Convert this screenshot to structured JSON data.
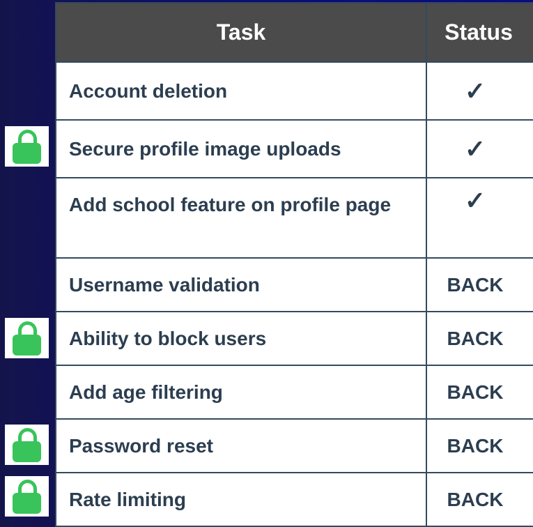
{
  "table": {
    "headers": {
      "task": "Task",
      "status": "Status"
    },
    "rows": [
      {
        "task": "Account deletion",
        "status": "✓",
        "locked": false
      },
      {
        "task": "Secure profile image uploads",
        "status": "✓",
        "locked": true
      },
      {
        "task": "Add school feature on profile page",
        "status": "✓",
        "locked": false
      },
      {
        "task": "Username validation",
        "status": "BACK",
        "locked": false
      },
      {
        "task": "Ability to block users",
        "status": "BACK",
        "locked": true
      },
      {
        "task": "Add age filtering",
        "status": "BACK",
        "locked": false
      },
      {
        "task": "Password reset",
        "status": "BACK",
        "locked": true
      },
      {
        "task": "Rate limiting",
        "status": "BACK",
        "locked": true
      }
    ]
  },
  "colors": {
    "header_bg": "#4b4b4b",
    "cell_text": "#2c3e50",
    "lock_green": "#38c45a",
    "background_navy": "#0c0c78"
  },
  "icons": {
    "lock": "lock-icon"
  }
}
